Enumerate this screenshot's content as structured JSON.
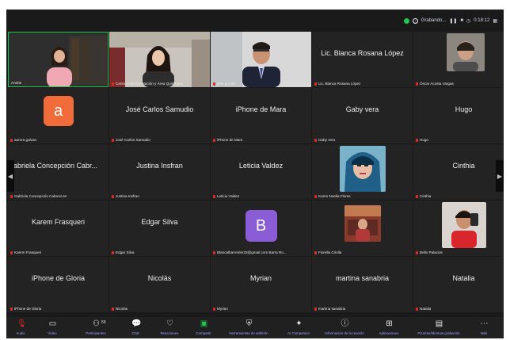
{
  "topbar": {
    "recording_label": "Grabando...",
    "time": "0:18:12"
  },
  "tiles": [
    {
      "type": "video",
      "name": "",
      "label": "Anette",
      "muted": false
    },
    {
      "type": "video",
      "name": "",
      "label": "Centro Instrumentación y Área Quirúrgica",
      "muted": true
    },
    {
      "type": "video",
      "name": "",
      "label": "jose gomez",
      "muted": true
    },
    {
      "type": "name",
      "name": "Lic. Blanca Rosana López",
      "label": "Lic. Blanca Rosana López",
      "muted": true
    },
    {
      "type": "photo",
      "name": "",
      "label": "Óscar Acosta Vargas",
      "muted": true
    },
    {
      "type": "avatar",
      "letter": "a",
      "color": "#f26b3a",
      "name": "",
      "label": "aurora galvan",
      "muted": true
    },
    {
      "type": "name",
      "name": "José Carlos Samudio",
      "label": "José Carlos Samudio",
      "muted": true
    },
    {
      "type": "name",
      "name": "iPhone de Mara",
      "label": "iPhone de Mara",
      "muted": true
    },
    {
      "type": "name",
      "name": "Gaby vera",
      "label": "Gaby vera",
      "muted": true
    },
    {
      "type": "name",
      "name": "Hugo",
      "label": "Hugo",
      "muted": true
    },
    {
      "type": "name",
      "name": "Gabriela Concepción Cabr...",
      "label": "Gabriela Concepción Cabrera M",
      "muted": true
    },
    {
      "type": "name",
      "name": "Justina Insfran",
      "label": "Justina Insfran",
      "muted": true
    },
    {
      "type": "name",
      "name": "Leticia Valdez",
      "label": "Leticia Valdez",
      "muted": true
    },
    {
      "type": "photo",
      "name": "",
      "label": "Karen Noelia Flores",
      "muted": true
    },
    {
      "type": "name",
      "name": "Cinthia",
      "label": "Cinthia",
      "muted": true
    },
    {
      "type": "name",
      "name": "Karem Frasqueri",
      "label": "Karem Frasqueri",
      "muted": true
    },
    {
      "type": "name",
      "name": "Edgar Silva",
      "label": "Edgar Silva",
      "muted": true
    },
    {
      "type": "avatar",
      "letter": "B",
      "color": "#8a5cd6",
      "name": "",
      "label": "Blancalbarrenler23@gmail.com Barra Ro...",
      "muted": true
    },
    {
      "type": "photo",
      "name": "",
      "label": "Fiorella Criolla",
      "muted": true
    },
    {
      "type": "photo",
      "name": "",
      "label": "Bello Palacios",
      "muted": true
    },
    {
      "type": "name",
      "name": "iPhone de Gloria",
      "label": "iPhone de Gloria",
      "muted": true
    },
    {
      "type": "name",
      "name": "Nicolás",
      "label": "Nicolás",
      "muted": true
    },
    {
      "type": "name",
      "name": "Myrian",
      "label": "Myrian",
      "muted": true
    },
    {
      "type": "name",
      "name": "martina sanabria",
      "label": "martina sanabria",
      "muted": true
    },
    {
      "type": "name",
      "name": "Natalia",
      "label": "Natalia",
      "muted": true
    }
  ],
  "toolbar": {
    "audio": "Audio",
    "video": "Video",
    "participants": "Participantes",
    "participants_count": "59",
    "chat": "Chat",
    "reactions": "Reacciones",
    "share": "Compartir",
    "whiteboard": "Herramientas de anfitrión",
    "companion": "AI Companion",
    "info": "Información de la reunión",
    "apps": "Aplicaciones",
    "more": "Pizarras/Idiomas grabación",
    "leave": "Más"
  },
  "colors": {
    "bg": "#1a1a1a",
    "tile": "#232323",
    "active_border": "#23c552",
    "toolbar": "#202020",
    "link": "#9aa3ff"
  }
}
